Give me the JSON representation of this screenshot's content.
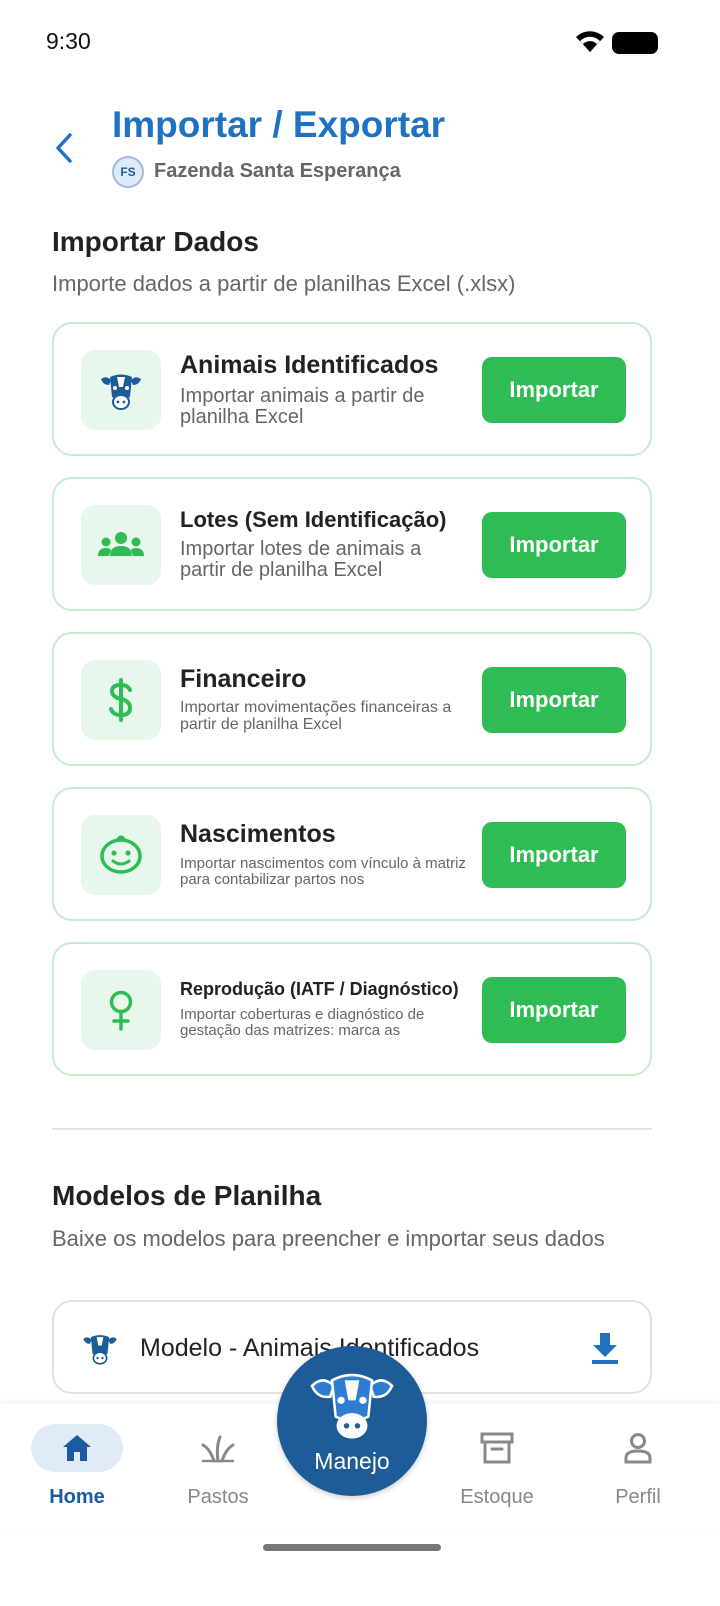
{
  "status_bar": {
    "time": "9:30"
  },
  "header": {
    "title": "Importar / Exportar",
    "farm_initials": "FS",
    "farm_name": "Fazenda Santa Esperança"
  },
  "import_section": {
    "title": "Importar Dados",
    "subtitle": "Importe dados a partir de planilhas Excel (.xlsx)",
    "cards": [
      {
        "icon": "cow-icon",
        "title": "Animais Identificados",
        "description": "Importar animais a partir de planilha Excel",
        "button": "Importar"
      },
      {
        "icon": "group-icon",
        "title": "Lotes (Sem Identificação)",
        "description": "Importar lotes de animais a partir de planilha Excel",
        "button": "Importar"
      },
      {
        "icon": "dollar-icon",
        "title": "Financeiro",
        "description": "Importar movimentações financeiras a partir de planilha Excel",
        "button": "Importar"
      },
      {
        "icon": "baby-face-icon",
        "title": "Nascimentos",
        "description": "Importar nascimentos com vínculo à matriz para contabilizar partos nos",
        "button": "Importar"
      },
      {
        "icon": "female-icon",
        "title": "Reprodução (IATF / Diagnóstico)",
        "description": "Importar coberturas e diagnóstico de gestação das matrizes: marca as",
        "button": "Importar"
      }
    ]
  },
  "templates_section": {
    "title": "Modelos de Planilha",
    "subtitle": "Baixe os modelos para preencher e importar seus dados",
    "items": [
      {
        "icon": "cow-icon",
        "label": "Modelo - Animais Identificados",
        "action_icon": "download-icon"
      }
    ]
  },
  "bottom_nav": {
    "items": [
      {
        "label": "Home",
        "icon": "home-icon",
        "active": true
      },
      {
        "label": "Pastos",
        "icon": "grass-icon",
        "active": false
      },
      {
        "label": "Manejo",
        "icon": "cow-icon",
        "active": false
      },
      {
        "label": "Estoque",
        "icon": "archive-icon",
        "active": false
      },
      {
        "label": "Perfil",
        "icon": "person-icon",
        "active": false
      }
    ]
  },
  "colors": {
    "primary_blue": "#1f72c2",
    "nav_blue": "#1d5b99",
    "import_green": "#2fbc54",
    "card_border": "#c7ebcf",
    "icon_bg": "#e8f7ec"
  }
}
